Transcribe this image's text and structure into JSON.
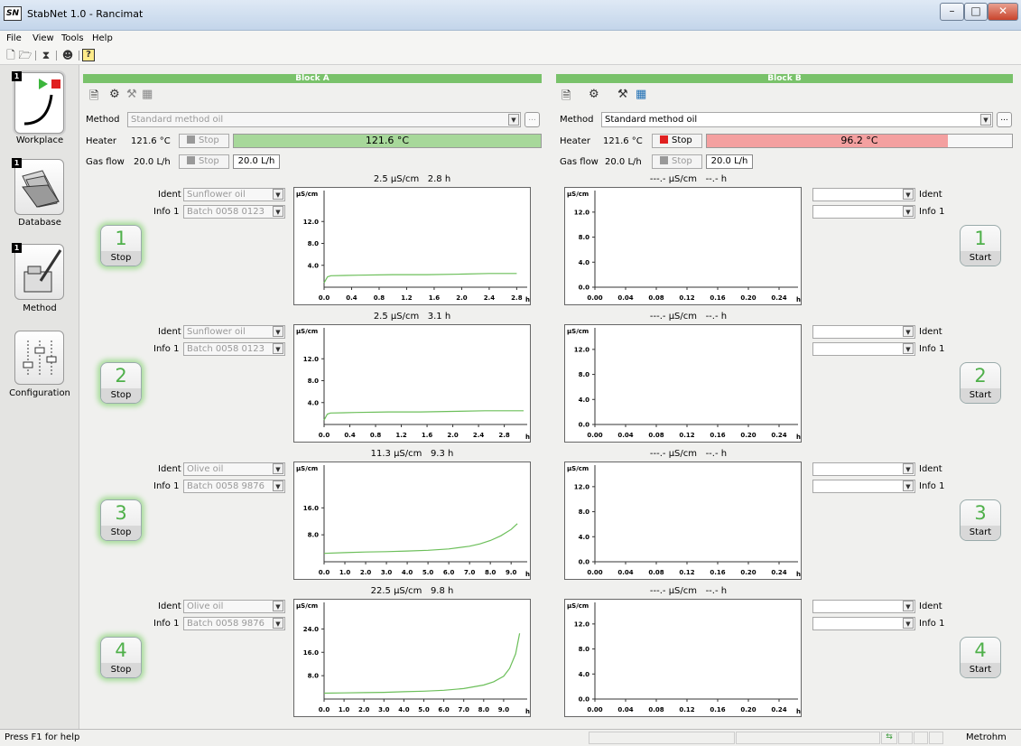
{
  "window": {
    "title": "StabNet 1.0 - Rancimat",
    "logo": "SN"
  },
  "menu": [
    "File",
    "View",
    "Tools",
    "Help"
  ],
  "toolbar_icons": [
    "new-method-icon",
    "open-method-icon",
    "hourglass-icon",
    "user-icon",
    "help-icon"
  ],
  "sidebar": {
    "items": [
      {
        "label": "Workplace",
        "badge": "1",
        "icon": "play-stop-curve-icon"
      },
      {
        "label": "Database",
        "badge": "1",
        "icon": "folder-icon"
      },
      {
        "label": "Method",
        "badge": "1",
        "icon": "flask-pen-icon"
      },
      {
        "label": "Configuration",
        "icon": "sliders-icon"
      }
    ]
  },
  "blocks": {
    "A": {
      "title": "Block A",
      "method_label": "Method",
      "method_value": "Standard method oil",
      "heater_label": "Heater",
      "heater_value": "121.6 °C",
      "heater_btn": "Stop",
      "heater_bar_text": "121.6 °C",
      "heater_progress": 1.0,
      "gas_label": "Gas flow",
      "gas_value": "20.0 L/h",
      "gas_btn": "Stop",
      "gas_box": "20.0 L/h"
    },
    "B": {
      "title": "Block B",
      "method_label": "Method",
      "method_value": "Standard method oil",
      "heater_label": "Heater",
      "heater_value": "121.6 °C",
      "heater_btn": "Stop",
      "heater_bar_text": "96.2 °C",
      "heater_progress": 0.79,
      "gas_label": "Gas flow",
      "gas_value": "20.0 L/h",
      "gas_btn": "Stop",
      "gas_box": "20.0 L/h"
    }
  },
  "slots_a": [
    {
      "num": "1",
      "status": "Stop",
      "ident_label": "Ident",
      "ident": "Sunflower oil",
      "info_label": "Info 1",
      "info": "Batch 0058 0123",
      "header_cond": "2.5 µS/cm",
      "header_time": "2.8 h"
    },
    {
      "num": "2",
      "status": "Stop",
      "ident_label": "Ident",
      "ident": "Sunflower oil",
      "info_label": "Info 1",
      "info": "Batch 0058 0123",
      "header_cond": "2.5 µS/cm",
      "header_time": "3.1 h"
    },
    {
      "num": "3",
      "status": "Stop",
      "ident_label": "Ident",
      "ident": "Olive oil",
      "info_label": "Info 1",
      "info": "Batch 0058 9876",
      "header_cond": "11.3 µS/cm",
      "header_time": "9.3 h"
    },
    {
      "num": "4",
      "status": "Stop",
      "ident_label": "Ident",
      "ident": "Olive oil",
      "info_label": "Info 1",
      "info": "Batch 0058 9876",
      "header_cond": "22.5 µS/cm",
      "header_time": "9.8 h"
    }
  ],
  "slots_b": [
    {
      "num": "1",
      "status": "Start",
      "ident_label": "Ident",
      "info_label": "Info 1",
      "header_cond": "---.- µS/cm",
      "header_time": "--.- h"
    },
    {
      "num": "2",
      "status": "Start",
      "ident_label": "Ident",
      "info_label": "Info 1",
      "header_cond": "---.- µS/cm",
      "header_time": "--.- h"
    },
    {
      "num": "3",
      "status": "Start",
      "ident_label": "Ident",
      "info_label": "Info 1",
      "header_cond": "---.- µS/cm",
      "header_time": "--.- h"
    },
    {
      "num": "4",
      "status": "Start",
      "ident_label": "Ident",
      "info_label": "Info 1",
      "header_cond": "---.- µS/cm",
      "header_time": "--.- h"
    }
  ],
  "chart_data": [
    {
      "type": "line",
      "ylabel": "µS/cm",
      "xunit": "h",
      "yticks": [
        "12.0",
        "8.0",
        "4.0"
      ],
      "yvals": [
        12,
        8,
        4
      ],
      "ylim": [
        0,
        16
      ],
      "xticks": [
        "0.0",
        "0.4",
        "0.8",
        "1.2",
        "1.6",
        "2.0",
        "2.4",
        "2.8"
      ],
      "xlim": [
        0,
        2.9
      ],
      "x": [
        0.0,
        0.05,
        0.1,
        0.5,
        1.0,
        1.5,
        2.0,
        2.4,
        2.8
      ],
      "y": [
        0.8,
        1.9,
        2.1,
        2.2,
        2.3,
        2.3,
        2.4,
        2.5,
        2.5
      ]
    },
    {
      "type": "line",
      "ylabel": "µS/cm",
      "xunit": "h",
      "yticks": [
        "12.0",
        "8.0",
        "4.0"
      ],
      "yvals": [
        12,
        8,
        4
      ],
      "ylim": [
        0,
        16
      ],
      "xticks": [
        "0.0",
        "0.4",
        "0.8",
        "1.2",
        "1.6",
        "2.0",
        "2.4",
        "2.8"
      ],
      "xlim": [
        0,
        3.1
      ],
      "x": [
        0.0,
        0.05,
        0.1,
        0.5,
        1.0,
        1.5,
        2.0,
        2.5,
        3.1
      ],
      "y": [
        0.8,
        1.9,
        2.1,
        2.2,
        2.3,
        2.3,
        2.4,
        2.5,
        2.5
      ]
    },
    {
      "type": "line",
      "ylabel": "µS/cm",
      "xunit": "h",
      "yticks": [
        "16.0",
        "8.0"
      ],
      "yvals": [
        16,
        8
      ],
      "ylim": [
        0,
        26
      ],
      "xticks": [
        "0.0",
        "1.0",
        "2.0",
        "3.0",
        "4.0",
        "5.0",
        "6.0",
        "7.0",
        "8.0",
        "9.0"
      ],
      "xlim": [
        0,
        9.6
      ],
      "x": [
        0.0,
        1.0,
        2.0,
        3.0,
        4.0,
        5.0,
        6.0,
        7.0,
        7.5,
        8.0,
        8.5,
        9.0,
        9.3
      ],
      "y": [
        2.5,
        2.7,
        2.9,
        3.0,
        3.2,
        3.4,
        3.8,
        4.6,
        5.3,
        6.3,
        7.7,
        9.6,
        11.3
      ]
    },
    {
      "type": "line",
      "ylabel": "µS/cm",
      "xunit": "h",
      "yticks": [
        "24.0",
        "16.0",
        "8.0"
      ],
      "yvals": [
        24,
        16,
        8
      ],
      "ylim": [
        0,
        30
      ],
      "xticks": [
        "0.0",
        "1.0",
        "2.0",
        "3.0",
        "4.0",
        "5.0",
        "6.0",
        "7.0",
        "8.0",
        "9.0"
      ],
      "xlim": [
        0,
        10.0
      ],
      "x": [
        0.0,
        1.0,
        2.0,
        3.0,
        4.0,
        5.0,
        6.0,
        7.0,
        8.0,
        8.5,
        9.0,
        9.3,
        9.6,
        9.8
      ],
      "y": [
        2.0,
        2.1,
        2.2,
        2.3,
        2.5,
        2.7,
        3.0,
        3.6,
        4.8,
        5.9,
        7.8,
        10.5,
        15.5,
        22.5
      ]
    },
    {
      "type": "line",
      "ylabel": "µS/cm",
      "xunit": "h",
      "yticks": [
        "12.0",
        "8.0",
        "4.0",
        "0.0"
      ],
      "yvals": [
        12,
        8,
        4,
        0
      ],
      "ylim": [
        0,
        14
      ],
      "xticks": [
        "0.00",
        "0.04",
        "0.08",
        "0.12",
        "0.16",
        "0.20",
        "0.24"
      ],
      "xlim": [
        0,
        0.26
      ],
      "x": [],
      "y": []
    },
    {
      "type": "line",
      "ylabel": "µS/cm",
      "xunit": "h",
      "yticks": [
        "12.0",
        "8.0",
        "4.0",
        "0.0"
      ],
      "yvals": [
        12,
        8,
        4,
        0
      ],
      "ylim": [
        0,
        14
      ],
      "xticks": [
        "0.00",
        "0.04",
        "0.08",
        "0.12",
        "0.16",
        "0.20",
        "0.24"
      ],
      "xlim": [
        0,
        0.26
      ],
      "x": [],
      "y": []
    },
    {
      "type": "line",
      "ylabel": "µS/cm",
      "xunit": "h",
      "yticks": [
        "12.0",
        "8.0",
        "4.0",
        "0.0"
      ],
      "yvals": [
        12,
        8,
        4,
        0
      ],
      "ylim": [
        0,
        14
      ],
      "xticks": [
        "0.00",
        "0.04",
        "0.08",
        "0.12",
        "0.16",
        "0.20",
        "0.24"
      ],
      "xlim": [
        0,
        0.26
      ],
      "x": [],
      "y": []
    },
    {
      "type": "line",
      "ylabel": "µS/cm",
      "xunit": "h",
      "yticks": [
        "12.0",
        "8.0",
        "4.0",
        "0.0"
      ],
      "yvals": [
        12,
        8,
        4,
        0
      ],
      "ylim": [
        0,
        14
      ],
      "xticks": [
        "0.00",
        "0.04",
        "0.08",
        "0.12",
        "0.16",
        "0.20",
        "0.24"
      ],
      "xlim": [
        0,
        0.26
      ],
      "x": [],
      "y": []
    }
  ],
  "status": {
    "help": "Press F1 for help",
    "vendor": "Metrohm"
  },
  "colors": {
    "accent_green": "#79c26a",
    "line_green": "#6cbf5a",
    "stop_red": "#e02020",
    "heater_a_bar": "#a7d89a",
    "heater_b_bar": "#f4a0a0"
  }
}
